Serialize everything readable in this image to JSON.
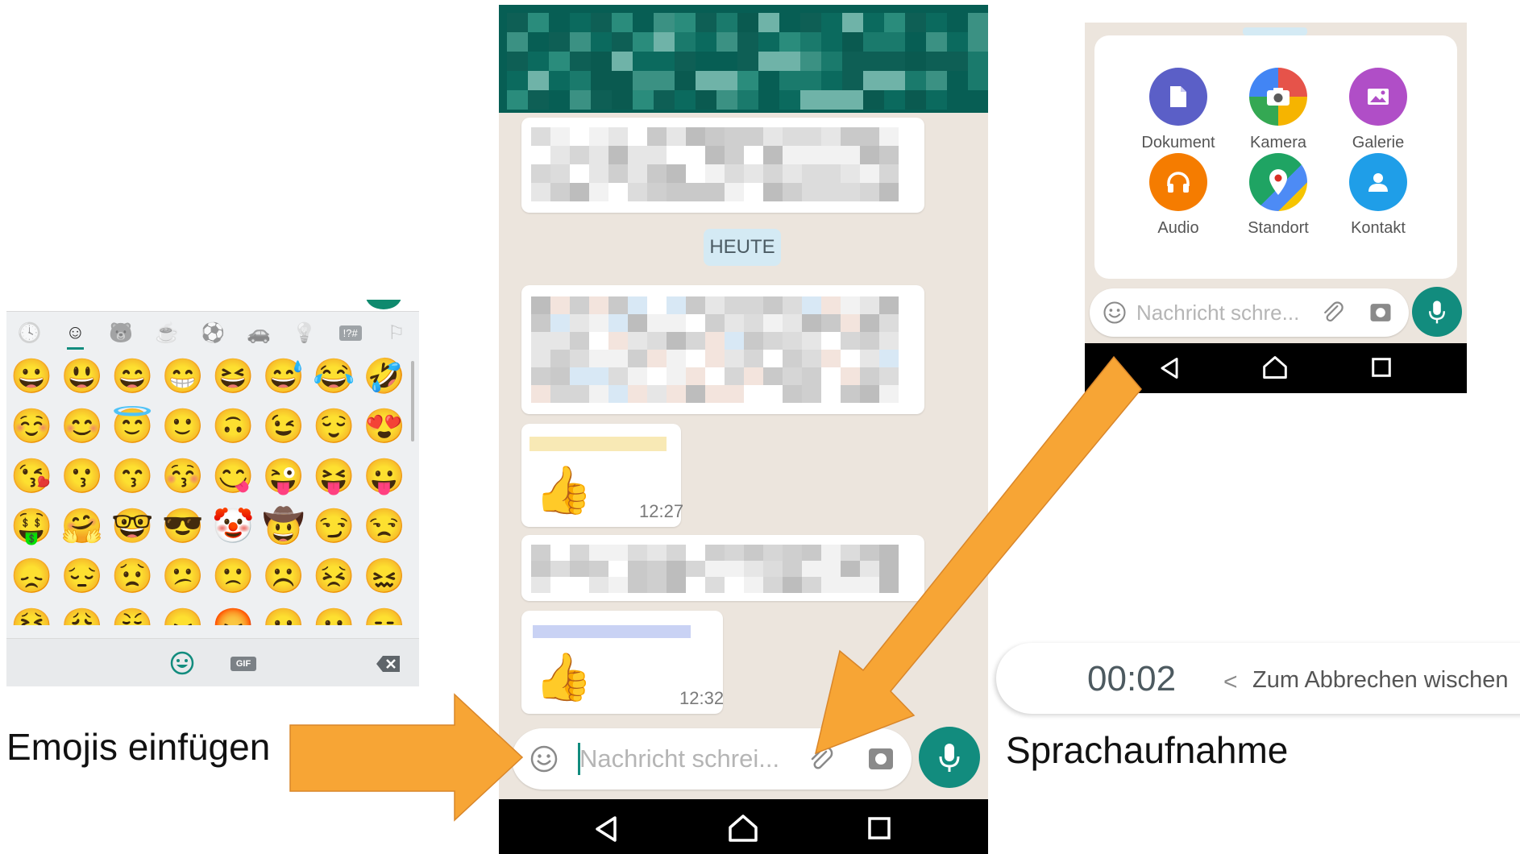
{
  "colors": {
    "whatsapp_teal_dark": "#075e54",
    "whatsapp_green": "#128c7e",
    "chat_background": "#ece5dd",
    "date_pill": "#d4eaf4",
    "arrow_orange": "#f7a535",
    "navbar": "#000000"
  },
  "emoji_keyboard": {
    "categories": [
      {
        "name": "recent",
        "icon": "clock-icon",
        "glyph": "🕓"
      },
      {
        "name": "smileys",
        "icon": "smiley-icon",
        "glyph": "☺"
      },
      {
        "name": "animals",
        "icon": "bear-icon",
        "glyph": "🐻"
      },
      {
        "name": "food",
        "icon": "cup-icon",
        "glyph": "☕"
      },
      {
        "name": "activity",
        "icon": "ball-icon",
        "glyph": "⚽"
      },
      {
        "name": "travel",
        "icon": "car-icon",
        "glyph": "🚗"
      },
      {
        "name": "objects",
        "icon": "bulb-icon",
        "glyph": "💡"
      },
      {
        "name": "symbols",
        "icon": "symbols-icon",
        "glyph": "!?#"
      },
      {
        "name": "flags",
        "icon": "flag-icon",
        "glyph": "⚐"
      }
    ],
    "emojis": [
      "😀",
      "😃",
      "😄",
      "😁",
      "😆",
      "😅",
      "😂",
      "🤣",
      "☺️",
      "😊",
      "😇",
      "🙂",
      "🙃",
      "😉",
      "😌",
      "😍",
      "😘",
      "😗",
      "😙",
      "😚",
      "😋",
      "😜",
      "😝",
      "😛",
      "🤑",
      "🤗",
      "🤓",
      "😎",
      "🤡",
      "🤠",
      "😏",
      "😒",
      "😞",
      "😔",
      "😟",
      "😕",
      "🙁",
      "☹️",
      "😣",
      "😖",
      "😫",
      "😩",
      "😤",
      "😠",
      "😡",
      "😶",
      "😐",
      "😑"
    ],
    "bottom": {
      "emoji_glyph": "☺",
      "gif_label": "GIF",
      "backspace_glyph": "✕"
    }
  },
  "chat": {
    "date_label": "HEUTE",
    "messages": [
      {
        "time": "12:27",
        "glyph": "👍"
      },
      {
        "time": "12:32",
        "glyph": "👍"
      }
    ],
    "input_placeholder": "Nachricht schrei..."
  },
  "attachment_panel": {
    "items": [
      {
        "label": "Dokument",
        "icon": "document-icon",
        "color": "#5b5fc7"
      },
      {
        "label": "Kamera",
        "icon": "camera-icon",
        "color": "#e6534a"
      },
      {
        "label": "Galerie",
        "icon": "gallery-icon",
        "color": "#b04ec7"
      },
      {
        "label": "Audio",
        "icon": "headphones-icon",
        "color": "#f57c00"
      },
      {
        "label": "Standort",
        "icon": "location-icon",
        "color": "#1fa463"
      },
      {
        "label": "Kontakt",
        "icon": "contact-icon",
        "color": "#1f9ee8"
      }
    ],
    "input_placeholder": "Nachricht schre..."
  },
  "recording": {
    "timer": "00:02",
    "chevron": "<",
    "hint": "Zum Abbrechen wischen"
  },
  "callouts": {
    "emoji": "Emojis einfügen",
    "voice": "Sprachaufnahme"
  }
}
